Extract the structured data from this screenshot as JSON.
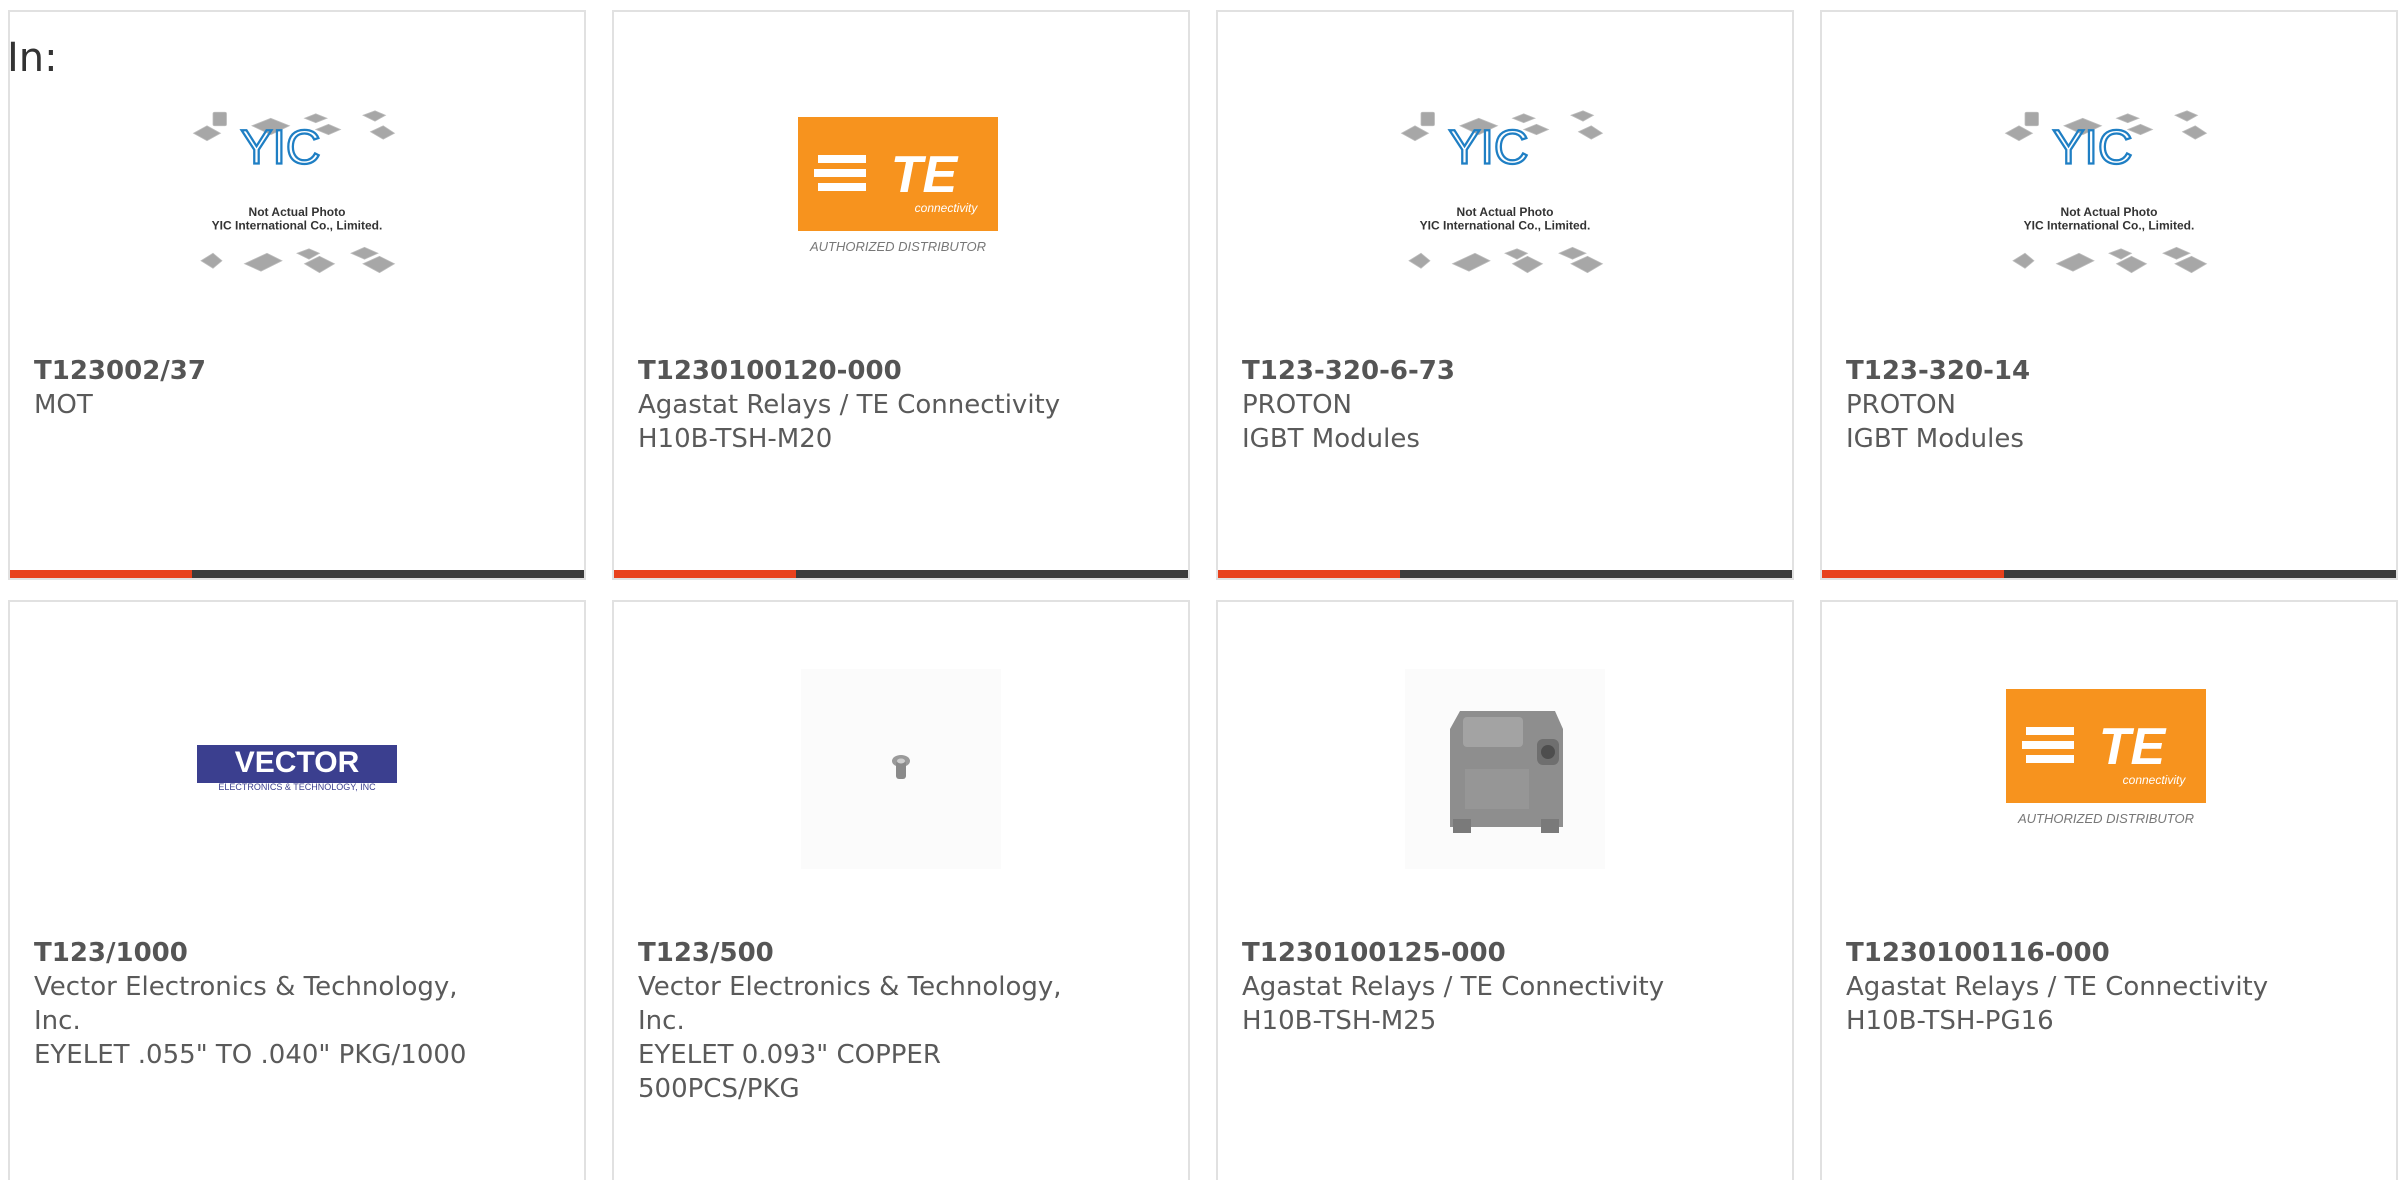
{
  "prefix": "In:",
  "images": {
    "yic": {
      "line1": "Not Actual Photo",
      "line2": "YIC International Co., Limited.",
      "logo": "YIC"
    },
    "te": {
      "logo": "TE",
      "sub": "connectivity",
      "caption": "AUTHORIZED DISTRIBUTOR",
      "color": "#f7931e"
    },
    "vector": {
      "logo": "VECTOR",
      "sub": "ELECTRONICS & TECHNOLOGY, INC",
      "color": "#3b3f8f"
    }
  },
  "products": [
    {
      "part": "T123002/37",
      "lines": [
        "MOT"
      ],
      "image": "yic"
    },
    {
      "part": "T1230100120-000",
      "lines": [
        "Agastat Relays / TE Connectivity",
        "H10B-TSH-M20"
      ],
      "image": "te"
    },
    {
      "part": "T123-320-6-73",
      "lines": [
        "PROTON",
        "IGBT Modules"
      ],
      "image": "yic"
    },
    {
      "part": "T123-320-14",
      "lines": [
        "PROTON",
        "IGBT Modules"
      ],
      "image": "yic"
    },
    {
      "part": "T123/1000",
      "lines": [
        "Vector Electronics & Technology,",
        "Inc.",
        "EYELET .055\" TO .040\" PKG/1000"
      ],
      "image": "vector"
    },
    {
      "part": "T123/500",
      "lines": [
        "Vector Electronics & Technology,",
        "Inc.",
        "EYELET 0.093\" COPPER",
        "500PCS/PKG"
      ],
      "image": "eyelet"
    },
    {
      "part": "T1230100125-000",
      "lines": [
        "Agastat Relays / TE Connectivity",
        "H10B-TSH-M25"
      ],
      "image": "hood"
    },
    {
      "part": "T1230100116-000",
      "lines": [
        "Agastat Relays / TE Connectivity",
        "H10B-TSH-PG16"
      ],
      "image": "te"
    }
  ],
  "colors": {
    "accent": "#e8411c",
    "bar": "#3b3b3b",
    "border": "#e1e1e1"
  }
}
